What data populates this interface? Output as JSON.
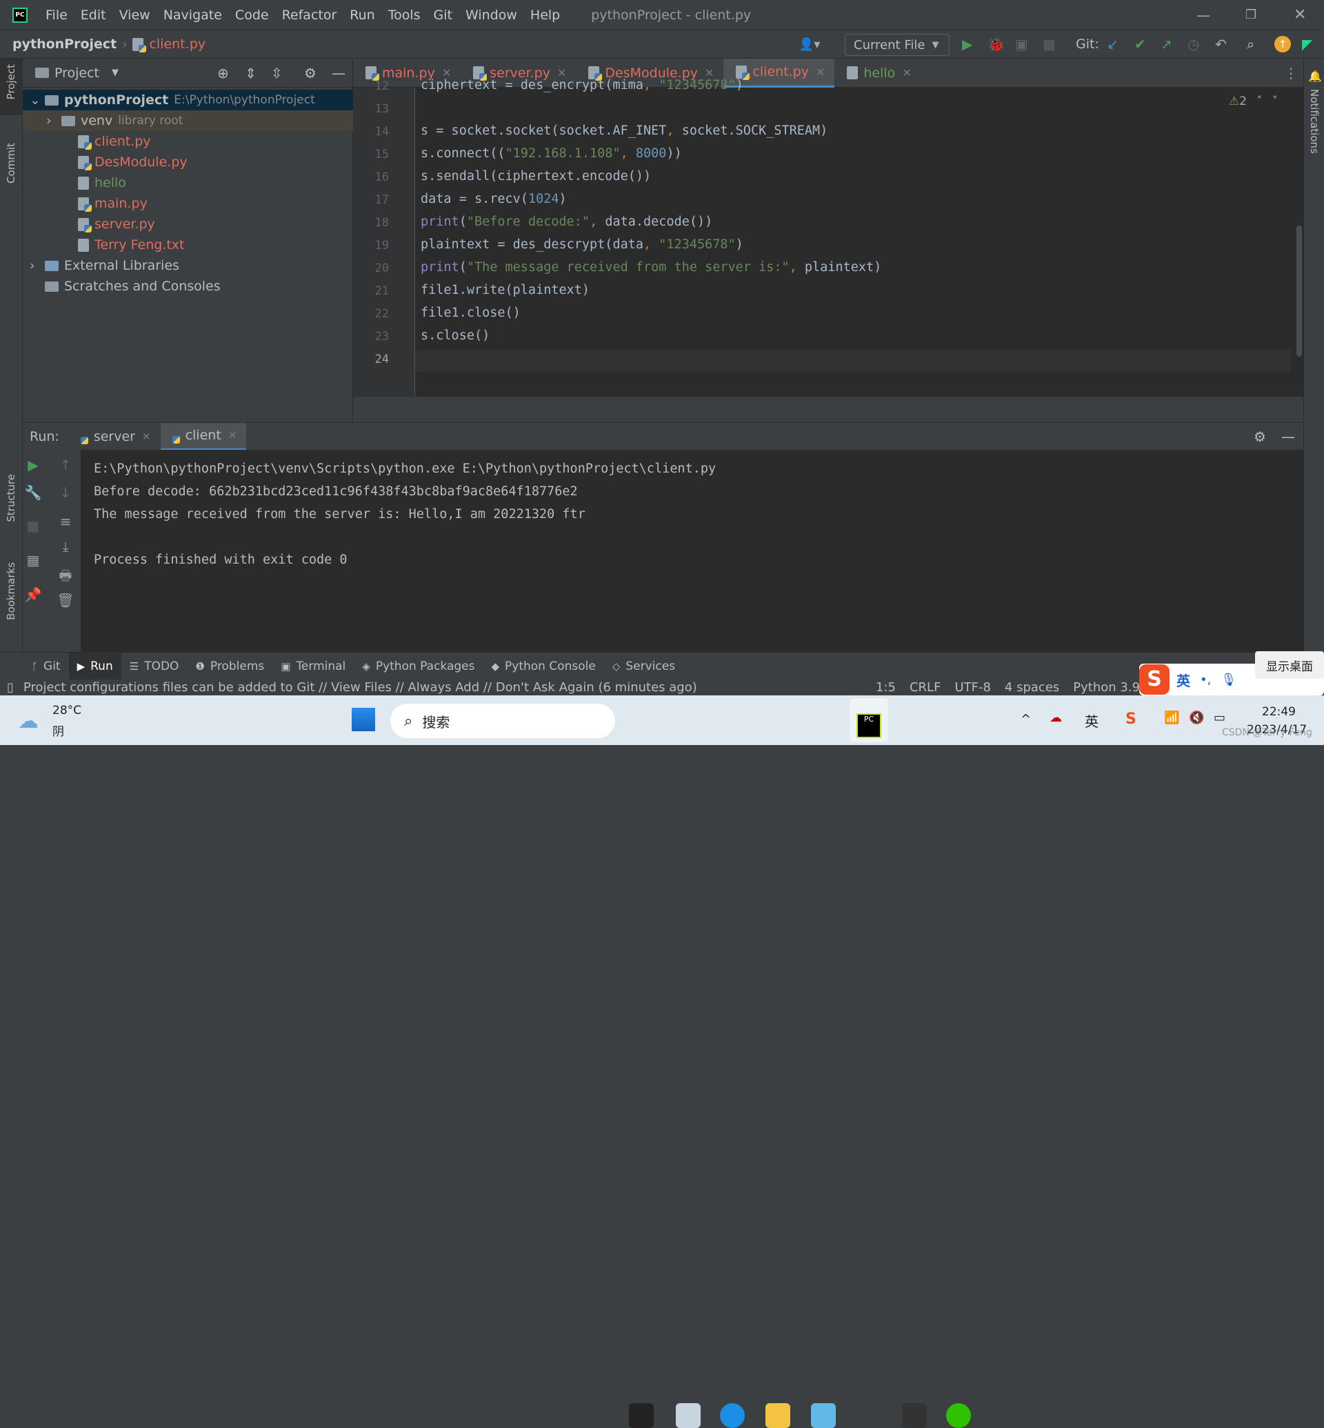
{
  "window": {
    "title": "pythonProject - client.py",
    "menu": [
      "File",
      "Edit",
      "View",
      "Navigate",
      "Code",
      "Refactor",
      "Run",
      "Tools",
      "Git",
      "Window",
      "Help"
    ]
  },
  "navbar": {
    "project": "pythonProject",
    "file": "client.py",
    "run_config": "Current File",
    "git_label": "Git:"
  },
  "left_strip": {
    "project": "Project",
    "commit": "Commit",
    "structure": "Structure",
    "bookmarks": "Bookmarks"
  },
  "right_strip": {
    "notifications": "Notifications"
  },
  "project_panel": {
    "title": "Project",
    "tree": [
      {
        "name": "pythonProject",
        "extra": "E:\\Python\\pythonProject",
        "type": "folder",
        "level": 0,
        "expanded": true,
        "color": "#bbbbbb"
      },
      {
        "name": "venv",
        "extra": "library root",
        "type": "folder",
        "level": 1,
        "expanded": false,
        "color": "#bbbbbb"
      },
      {
        "name": "client.py",
        "type": "py",
        "level": 2,
        "color": "#e06c5c"
      },
      {
        "name": "DesModule.py",
        "type": "py",
        "level": 2,
        "color": "#e06c5c"
      },
      {
        "name": "hello",
        "type": "file",
        "level": 2,
        "color": "#6a9955"
      },
      {
        "name": "main.py",
        "type": "py",
        "level": 2,
        "color": "#e06c5c"
      },
      {
        "name": "server.py",
        "type": "py",
        "level": 2,
        "color": "#e06c5c"
      },
      {
        "name": "Terry Feng.txt",
        "type": "file",
        "level": 2,
        "color": "#e06c5c"
      },
      {
        "name": "External Libraries",
        "type": "lib",
        "level": 0,
        "expanded": false,
        "color": "#bbbbbb"
      },
      {
        "name": "Scratches and Consoles",
        "type": "scratch",
        "level": 0,
        "color": "#bbbbbb"
      }
    ]
  },
  "editor": {
    "tabs": [
      {
        "label": "main.py",
        "color": "#e06c5c",
        "active": false
      },
      {
        "label": "server.py",
        "color": "#e06c5c",
        "active": false
      },
      {
        "label": "DesModule.py",
        "color": "#e06c5c",
        "active": false
      },
      {
        "label": "client.py",
        "color": "#e06c5c",
        "active": true
      },
      {
        "label": "hello",
        "color": "#6a9955",
        "active": false
      }
    ],
    "warnings": "2",
    "lines": [
      {
        "n": "12",
        "code": "ciphertext = des_encrypt(mima, \"12345678\")"
      },
      {
        "n": "13",
        "code": ""
      },
      {
        "n": "14",
        "code": "s = socket.socket(socket.AF_INET, socket.SOCK_STREAM)"
      },
      {
        "n": "15",
        "code": "s.connect((\"192.168.1.108\", 8000))"
      },
      {
        "n": "16",
        "code": "s.sendall(ciphertext.encode())"
      },
      {
        "n": "17",
        "code": "data = s.recv(1024)"
      },
      {
        "n": "18",
        "code": "print(\"Before decode:\", data.decode())"
      },
      {
        "n": "19",
        "code": "plaintext = des_descrypt(data, \"12345678\")"
      },
      {
        "n": "20",
        "code": "print(\"The message received from the server is:\", plaintext)"
      },
      {
        "n": "21",
        "code": "file1.write(plaintext)"
      },
      {
        "n": "22",
        "code": "file1.close()"
      },
      {
        "n": "23",
        "code": "s.close()"
      },
      {
        "n": "24",
        "code": ""
      }
    ]
  },
  "run": {
    "label": "Run:",
    "tabs": [
      {
        "label": "server",
        "active": false
      },
      {
        "label": "client",
        "active": true
      }
    ],
    "output": [
      "E:\\Python\\pythonProject\\venv\\Scripts\\python.exe E:\\Python\\pythonProject\\client.py",
      "Before decode: 662b231bcd23ced11c96f438f43bc8baf9ac8e64f18776e2",
      "The message received from the server is: Hello,I am 20221320 ftr",
      "",
      "Process finished with exit code 0"
    ]
  },
  "tool_windows": [
    "Git",
    "Run",
    "TODO",
    "Problems",
    "Terminal",
    "Python Packages",
    "Python Console",
    "Services"
  ],
  "status": {
    "message": "Project configurations files can be added to Git // View Files // Always Add // Don't Ask Again (6 minutes ago)",
    "position": "1:5",
    "line_sep": "CRLF",
    "encoding": "UTF-8",
    "indent": "4 spaces",
    "interpreter": "Python 3.9 (py"
  },
  "taskbar": {
    "temp": "28°C",
    "weather": "阴",
    "search": "搜索",
    "time": "22:49",
    "date": "2023/4/17",
    "show_desktop": "显示桌面",
    "ime": "英",
    "tray_lang": "英",
    "watermark": "CSDN @Terry Feng"
  }
}
